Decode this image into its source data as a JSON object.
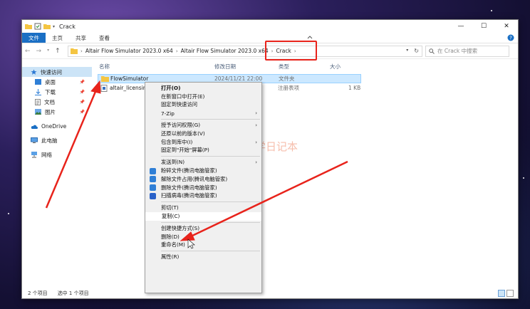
{
  "window": {
    "title": "Crack",
    "controls": {
      "minimize": "—",
      "maximize": "☐",
      "close": "✕"
    }
  },
  "ribbon": {
    "tabs": [
      "文件",
      "主页",
      "共享",
      "查看"
    ]
  },
  "address": {
    "crumbs": [
      "Altair Flow Simulator 2023.0 x64",
      "Altair Flow Simulator 2023.0 x64",
      "Crack"
    ],
    "search_placeholder": "在 Crack 中搜索"
  },
  "sidebar": {
    "items": [
      {
        "label": "快速访问"
      },
      {
        "label": "桌面"
      },
      {
        "label": "下载"
      },
      {
        "label": "文档"
      },
      {
        "label": "图片"
      },
      {
        "label": "OneDrive"
      },
      {
        "label": "此电脑"
      },
      {
        "label": "网络"
      }
    ]
  },
  "columns": {
    "name": "名称",
    "date": "修改日期",
    "type": "类型",
    "size": "大小"
  },
  "files": [
    {
      "name": "FlowSimulator",
      "date": "2024/11/21 22:00",
      "type": "文件夹",
      "size": ""
    },
    {
      "name": "altair_licensing",
      "date": "",
      "type": "注册表项",
      "size": "1 KB"
    }
  ],
  "context_menu": {
    "items": [
      "打开(O)",
      "在新窗口中打开(E)",
      "固定到快速访问",
      "7-Zip",
      "授予访问权限(G)",
      "还原以前的版本(V)",
      "包含到库中(I)",
      "固定到\"开始\"屏幕(P)",
      "发送到(N)",
      "粉碎文件(腾讯电脑管家)",
      "解除文件占用(腾讯电脑管家)",
      "删除文件(腾讯电脑管家)",
      "扫描病毒(腾讯电脑管家)",
      "剪切(T)",
      "复制(C)",
      "创建快捷方式(S)",
      "删除(D)",
      "重命名(M)",
      "属性(R)"
    ]
  },
  "status": {
    "count": "2 个项目",
    "selected": "选中 1 个项目"
  },
  "watermark": {
    "text": "丁同学日记本"
  },
  "colors": {
    "accent": "#1a6fc4",
    "annotation": "#e8231b",
    "selection": "#cce8ff",
    "folder": "#f4c542"
  }
}
